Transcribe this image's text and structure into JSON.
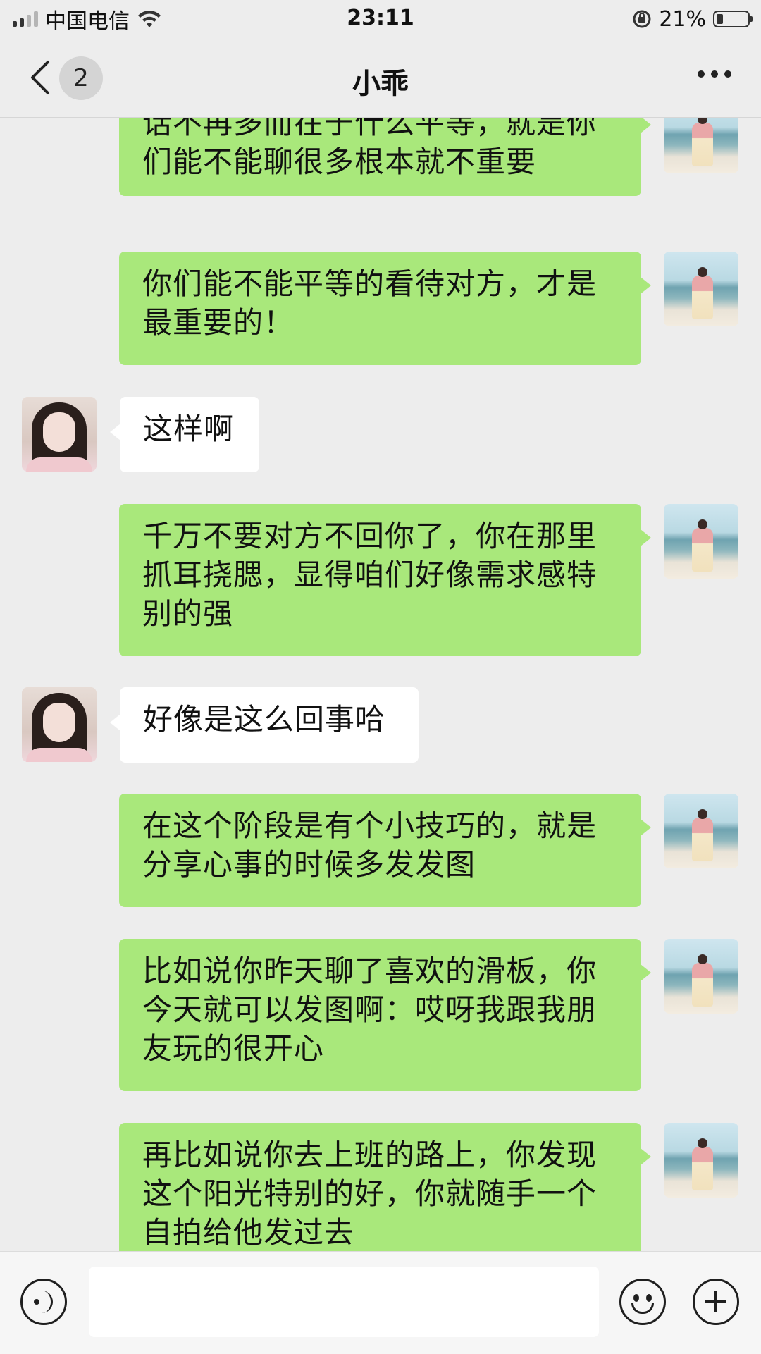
{
  "status_bar": {
    "carrier": "中国电信",
    "time": "23:11",
    "battery": "21%",
    "battery_level": 0.21,
    "icons": [
      "signal-icon",
      "wifi-icon",
      "rotation-lock-icon",
      "battery-icon"
    ]
  },
  "nav": {
    "back_icon": "chevron-left-icon",
    "unread_count": "2",
    "title": "小乖",
    "more_icon": "more-dots-icon"
  },
  "messages": [
    {
      "sender": "self",
      "text": "话不再多而在于什么平等，就是你们能不能聊很多根本就不重要"
    },
    {
      "sender": "self",
      "text": "你们能不能平等的看待对方，才是最重要的！"
    },
    {
      "sender": "other",
      "text": "这样啊"
    },
    {
      "sender": "self",
      "text": "千万不要对方不回你了，你在那里抓耳挠腮，显得咱们好像需求感特别的强"
    },
    {
      "sender": "other",
      "text": "好像是这么回事哈"
    },
    {
      "sender": "self",
      "text": "在这个阶段是有个小技巧的，就是分享心事的时候多发发图"
    },
    {
      "sender": "self",
      "text": "比如说你昨天聊了喜欢的滑板，你今天就可以发图啊：哎呀我跟我朋友玩的很开心"
    },
    {
      "sender": "self",
      "text": "再比如说你去上班的路上，你发现这个阳光特别的好，你就随手一个自拍给他发过去"
    }
  ],
  "input_bar": {
    "voice_icon": "voice-icon",
    "input_value": "",
    "emoji_icon": "emoji-icon",
    "plus_icon": "plus-icon"
  }
}
